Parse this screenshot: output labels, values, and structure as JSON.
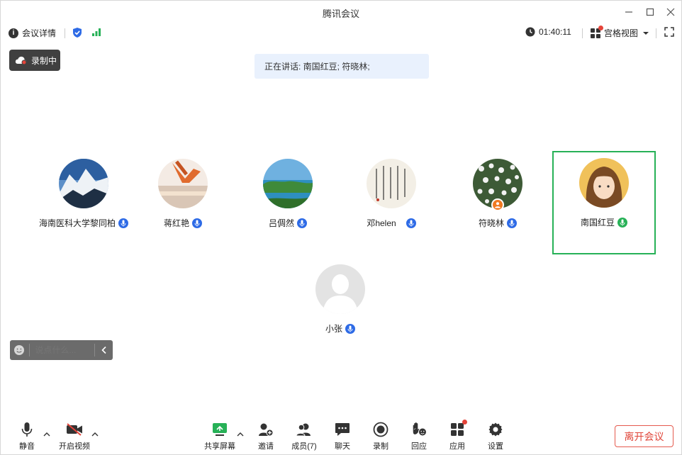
{
  "window": {
    "title": "腾讯会议"
  },
  "topbar": {
    "meeting_details": "会议详情",
    "timer": "01:40:11",
    "view_mode": "宫格视图"
  },
  "recording_badge": "录制中",
  "speaking_banner": "正在讲话: 南国红豆; 符晓林;",
  "participants": [
    {
      "name": "海南医科大学黎同柏",
      "mic": "on",
      "active": false
    },
    {
      "name": "蒋红艳",
      "mic": "on",
      "active": false
    },
    {
      "name": "吕倜然",
      "mic": "on",
      "active": false
    },
    {
      "name": "邓helen",
      "mic": "on",
      "active": false
    },
    {
      "name": "符晓林",
      "mic": "on",
      "active": false
    },
    {
      "name": "南国红豆",
      "mic": "speaking",
      "active": true
    },
    {
      "name": "小张",
      "mic": "on",
      "active": false
    }
  ],
  "chat": {
    "placeholder": "说点什么..."
  },
  "bottombar": {
    "mute": "静音",
    "video": "开启视频",
    "share": "共享屏幕",
    "invite": "邀请",
    "members": "成员(7)",
    "chat": "聊天",
    "record": "录制",
    "react": "回应",
    "apps": "应用",
    "settings": "设置",
    "leave": "离开会议"
  },
  "colors": {
    "accent_blue": "#2e6be6",
    "active_green": "#27b157",
    "leave_red": "#e0463a",
    "banner_bg": "#e9f1fd"
  }
}
